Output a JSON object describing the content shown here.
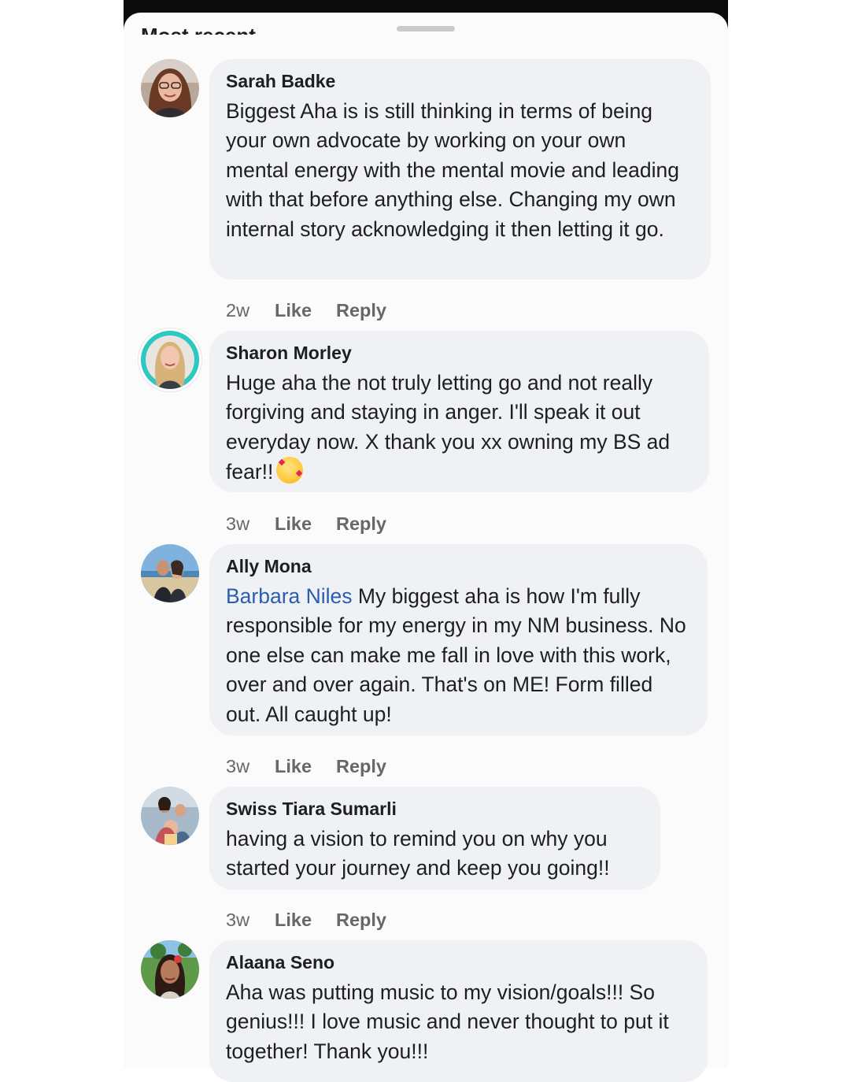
{
  "header": {
    "sort_label": "Most recent"
  },
  "comments": [
    {
      "author": "Sarah Badke",
      "mention": "",
      "text": "Biggest Aha is is still thinking in terms of being your own advocate by working on your own mental energy with the mental movie and leading with that before anything else. Changing my own internal story acknowledging it then letting it go.",
      "time": "2w",
      "like_label": "Like",
      "reply_label": "Reply",
      "avatar_icon": "profile-photo-woman-glasses"
    },
    {
      "author": "Sharon Morley",
      "mention": "",
      "text": "Huge aha the not truly letting go and not really forgiving and staying in anger. I'll speak it out everyday now. X thank you xx owning my BS ad fear!!",
      "emoji": "smiling-face-with-hearts",
      "time": "3w",
      "like_label": "Like",
      "reply_label": "Reply",
      "avatar_icon": "profile-photo-blonde-woman"
    },
    {
      "author": "Ally Mona",
      "mention": "Barbara Niles",
      "text": " My biggest aha is how I'm fully responsible for my energy in my NM business. No one else can make me fall in love with this work, over and over again. That's on ME! Form filled out. All caught up!",
      "time": "3w",
      "like_label": "Like",
      "reply_label": "Reply",
      "avatar_icon": "profile-photo-couple-beach"
    },
    {
      "author": "Swiss Tiara Sumarli",
      "mention": "",
      "text": "having a vision to remind you on why you started your journey and keep you going!!",
      "time": "3w",
      "like_label": "Like",
      "reply_label": "Reply",
      "avatar_icon": "profile-photo-family"
    },
    {
      "author": "Alaana Seno",
      "mention": "",
      "text": "Aha was putting music to my vision/goals!!! So genius!!! I love music and never thought to put it together! Thank you!!!",
      "time": "",
      "like_label": "",
      "reply_label": "",
      "avatar_icon": "profile-photo-woman-outdoors"
    }
  ],
  "colors": {
    "bubble": "#f0f1f4",
    "mention": "#2a5db0",
    "meta": "#65676b",
    "topbar": "#0b0b0c"
  }
}
